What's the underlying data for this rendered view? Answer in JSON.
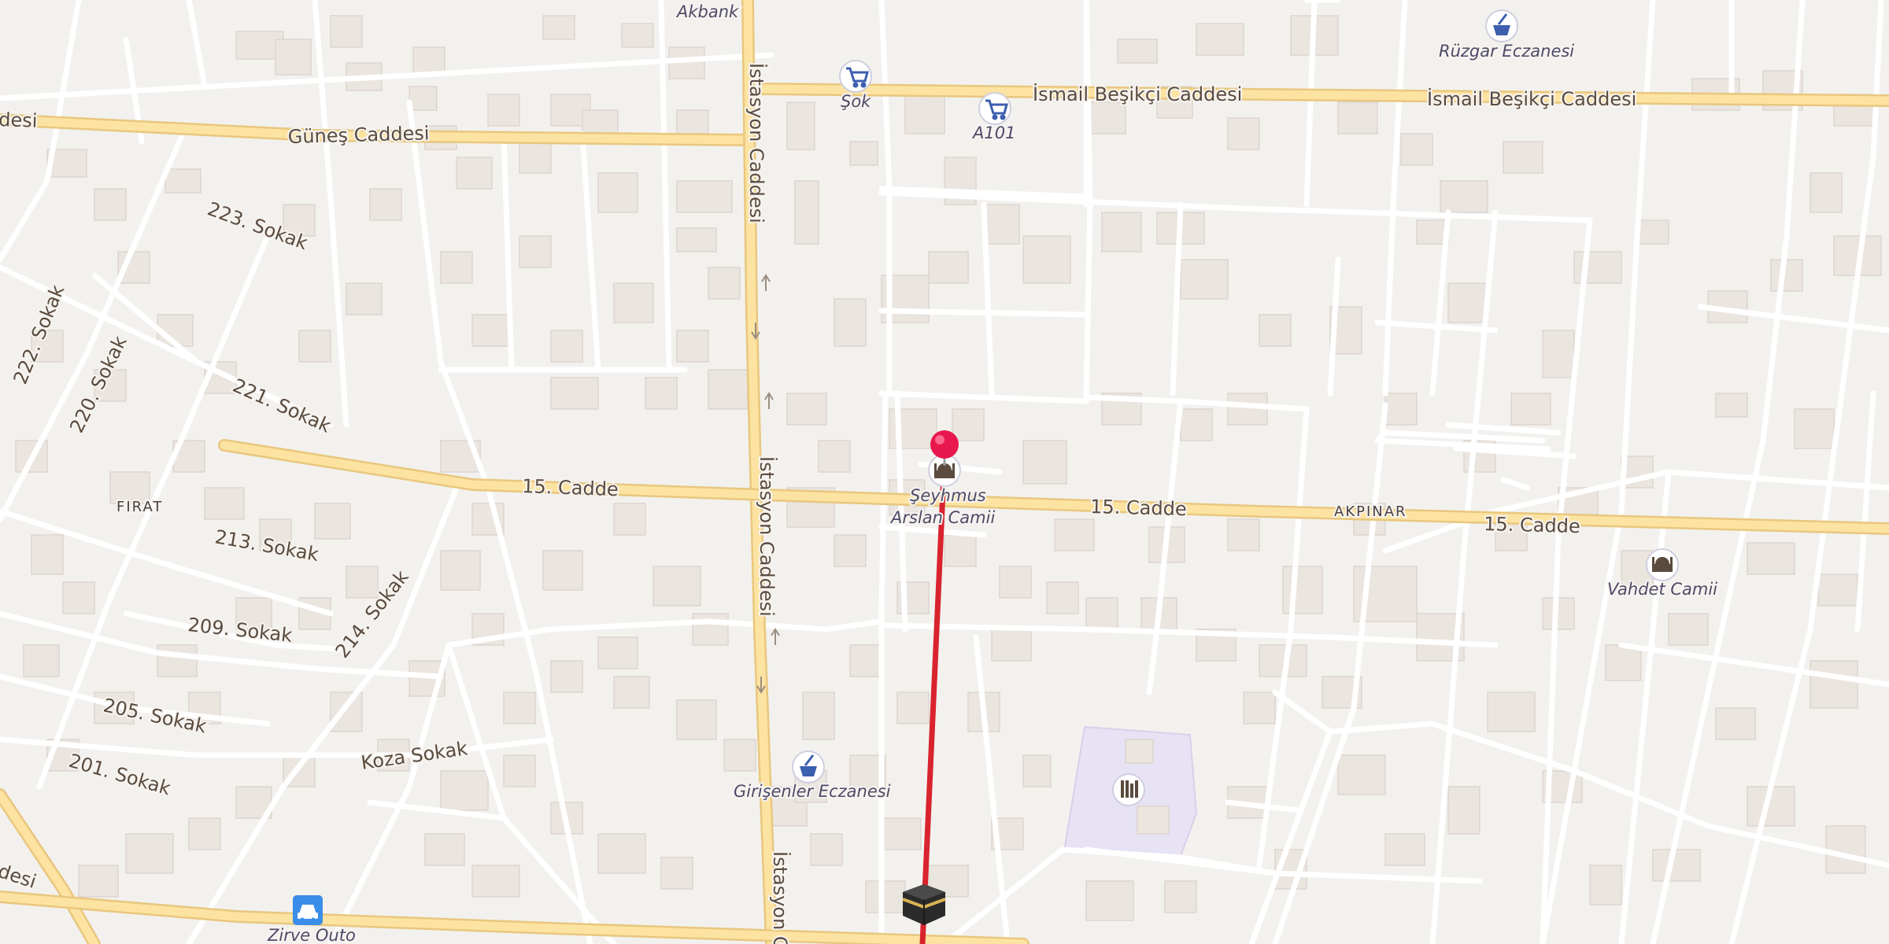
{
  "map": {
    "streets": {
      "gunes": "Güneş Caddesi",
      "ismail_1": "İsmail Beşikçi Caddesi",
      "ismail_2": "İsmail Beşikçi Caddesi",
      "istasyon_1": "İstasyon Caddesi",
      "istasyon_2": "İstasyon Caddesi",
      "istasyon_3": "İstasyon C",
      "cadde15_1": "15. Cadde",
      "cadde15_2": "15. Cadde",
      "cadde15_3": "15. Cadde",
      "s223": "223. Sokak",
      "s222": "222. Sokak",
      "s220": "220. Sokak",
      "s221": "221. Sokak",
      "s213": "213. Sokak",
      "s214": "214. Sokak",
      "s209": "209. Sokak",
      "s205": "205. Sokak",
      "s201": "201. Sokak",
      "koza": "Koza Sokak",
      "desi_left_top": "desi",
      "desi_left_bottom": "desi"
    },
    "districts": {
      "firat": "FIRAT",
      "akpinar": "AKPINAR"
    },
    "pois": {
      "akbank": "Akbank",
      "sok": "Şok",
      "a101": "A101",
      "ruzgar": "Rüzgar Eczanesi",
      "mosque_line1": "Şeyhmus",
      "mosque_line2": "Arslan Camii",
      "vahdet": "Vahdet Camii",
      "girisenler": "Girişenler Eczanesi",
      "zirve": "Zirve Outo"
    },
    "icons": {
      "supermarket": "cart-icon",
      "pharmacy": "mortar-pestle-icon",
      "mosque": "mosque-icon",
      "library": "books-icon",
      "car_service": "car-icon",
      "destination": "kaaba-icon",
      "marker": "location-pin-icon"
    },
    "colors": {
      "background": "#f3f1ee",
      "major_road": "#fde3a2",
      "route": "#d9232e",
      "marker": "#e8174d",
      "school_area": "#e7e2f4",
      "poi_blue": "#3c5fae"
    }
  }
}
